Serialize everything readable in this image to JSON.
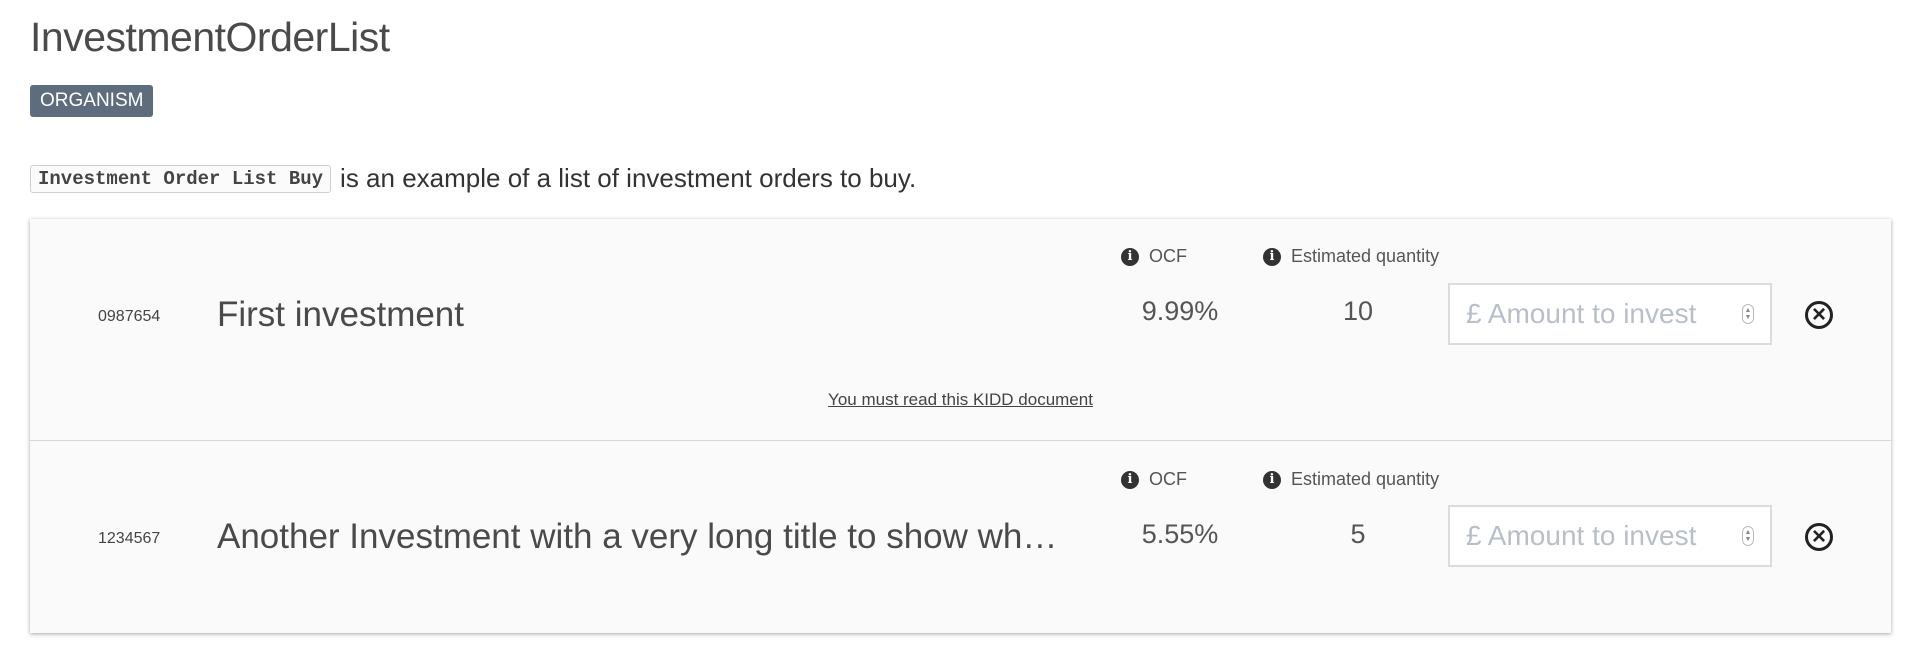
{
  "page": {
    "title": "InvestmentOrderList",
    "badge": "ORGANISM",
    "intro_code": "Investment Order List Buy",
    "intro_text": "is an example of a list of investment orders to buy."
  },
  "labels": {
    "ocf": "OCF",
    "estimated_quantity": "Estimated quantity",
    "amount_placeholder": "£ Amount to invest"
  },
  "orders": [
    {
      "code": "0987654",
      "name": "First investment",
      "ocf": "9.99%",
      "quantity": "10",
      "kidd_link": "You must read this KIDD document"
    },
    {
      "code": "1234567",
      "name": "Another Investment with a very long title to show whe…",
      "ocf": "5.55%",
      "quantity": "5"
    }
  ],
  "icons": {
    "info": "info-icon",
    "remove": "close-circle-icon",
    "spinner": "number-spinner-icon"
  },
  "colors": {
    "badge_bg": "#5d6d7d",
    "panel_bg": "#fafafa",
    "placeholder": "#b8bfc8"
  }
}
